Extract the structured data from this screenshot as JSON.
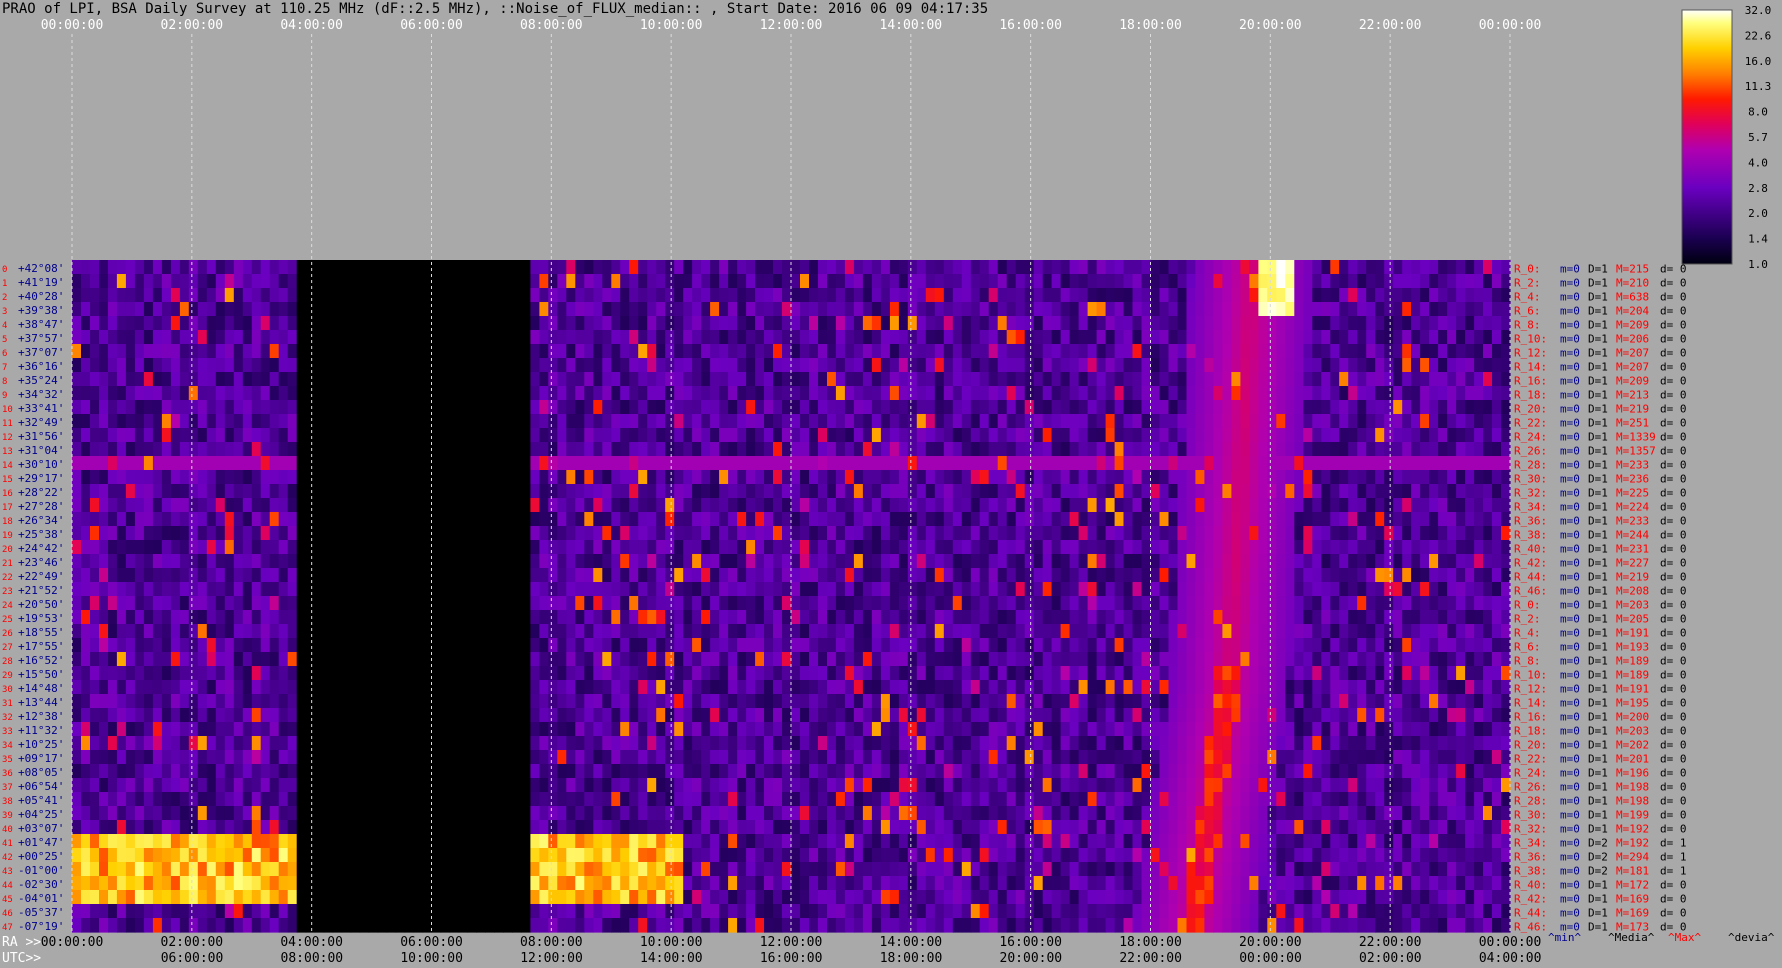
{
  "title": "PRAO of LPI, BSA Daily Survey at 110.25 MHz (dF::2.5 MHz), ::Noise_of_FLUX_median:: , Start Date: 2016 06 09 04:17:35",
  "chart_data": {
    "type": "heatmap",
    "title": "PRAO of LPI, BSA Daily Survey at 110.25 MHz (dF::2.5 MHz), ::Noise_of_FLUX_median:: , Start Date: 2016 06 09 04:17:35",
    "top_time_ticks": [
      "00:00:00",
      "02:00:00",
      "04:00:00",
      "06:00:00",
      "08:00:00",
      "10:00:00",
      "12:00:00",
      "14:00:00",
      "16:00:00",
      "18:00:00",
      "20:00:00",
      "22:00:00",
      "00:00:00"
    ],
    "ra_axis_label": "RA >>",
    "ra_ticks": [
      "00:00:00",
      "02:00:00",
      "04:00:00",
      "06:00:00",
      "08:00:00",
      "10:00:00",
      "12:00:00",
      "14:00:00",
      "16:00:00",
      "18:00:00",
      "20:00:00",
      "22:00:00",
      "00:00:00"
    ],
    "utc_axis_label": "UTC>>",
    "utc_ticks": [
      "06:00:00",
      "08:00:00",
      "10:00:00",
      "12:00:00",
      "14:00:00",
      "16:00:00",
      "18:00:00",
      "20:00:00",
      "22:00:00",
      "00:00:00",
      "02:00:00",
      "04:00:00"
    ],
    "declinations": [
      "+42°08'",
      "+41°19'",
      "+40°28'",
      "+39°38'",
      "+38°47'",
      "+37°57'",
      "+37°07'",
      "+36°16'",
      "+35°24'",
      "+34°32'",
      "+33°41'",
      "+32°49'",
      "+31°56'",
      "+31°04'",
      "+30°10'",
      "+29°17'",
      "+28°22'",
      "+27°28'",
      "+26°34'",
      "+25°38'",
      "+24°42'",
      "+23°46'",
      "+22°49'",
      "+21°52'",
      "+20°50'",
      "+19°53'",
      "+18°55'",
      "+17°55'",
      "+16°52'",
      "+15°50'",
      "+14°48'",
      "+13°44'",
      "+12°38'",
      "+11°32'",
      "+10°25'",
      "+09°17'",
      "+08°05'",
      "+06°54'",
      "+05°41'",
      "+04°25'",
      "+03°07'",
      "+01°47'",
      "+00°25'",
      "-01°00'",
      "-02°30'",
      "-04°01'",
      "-05°37'",
      "-07°19'"
    ],
    "beam_numbers": [
      "0",
      "1",
      "2",
      "3",
      "4",
      "5",
      "6",
      "7",
      "8",
      "9",
      "10",
      "11",
      "12",
      "13",
      "14",
      "15",
      "16",
      "17",
      "18",
      "19",
      "20",
      "21",
      "22",
      "23",
      "24",
      "25",
      "26",
      "27",
      "28",
      "29",
      "30",
      "31",
      "32",
      "33",
      "34",
      "35",
      "36",
      "37",
      "38",
      "39",
      "40",
      "41",
      "42",
      "43",
      "44",
      "45",
      "46",
      "47"
    ],
    "colorbar_ticks": [
      "32.0",
      "22.6",
      "16.0",
      "11.3",
      "8.0",
      "5.7",
      "4.0",
      "2.8",
      "2.0",
      "1.4",
      "1.0"
    ],
    "channels": [
      {
        "r": "R_0:",
        "min": "m=0",
        "dev": "D=1",
        "max": "M=215",
        "d": "d= 0"
      },
      {
        "r": "R_2:",
        "min": "m=0",
        "dev": "D=1",
        "max": "M=210",
        "d": "d= 0"
      },
      {
        "r": "R_4:",
        "min": "m=0",
        "dev": "D=1",
        "max": "M=638",
        "d": "d= 0"
      },
      {
        "r": "R_6:",
        "min": "m=0",
        "dev": "D=1",
        "max": "M=204",
        "d": "d= 0"
      },
      {
        "r": "R_8:",
        "min": "m=0",
        "dev": "D=1",
        "max": "M=209",
        "d": "d= 0"
      },
      {
        "r": "R_10:",
        "min": "m=0",
        "dev": "D=1",
        "max": "M=206",
        "d": "d= 0"
      },
      {
        "r": "R_12:",
        "min": "m=0",
        "dev": "D=1",
        "max": "M=207",
        "d": "d= 0"
      },
      {
        "r": "R_14:",
        "min": "m=0",
        "dev": "D=1",
        "max": "M=207",
        "d": "d= 0"
      },
      {
        "r": "R_16:",
        "min": "m=0",
        "dev": "D=1",
        "max": "M=209",
        "d": "d= 0"
      },
      {
        "r": "R_18:",
        "min": "m=0",
        "dev": "D=1",
        "max": "M=213",
        "d": "d= 0"
      },
      {
        "r": "R_20:",
        "min": "m=0",
        "dev": "D=1",
        "max": "M=219",
        "d": "d= 0"
      },
      {
        "r": "R_22:",
        "min": "m=0",
        "dev": "D=1",
        "max": "M=251",
        "d": "d= 0"
      },
      {
        "r": "R_24:",
        "min": "m=0",
        "dev": "D=1",
        "max": "M=1339",
        "d": "d= 0"
      },
      {
        "r": "R_26:",
        "min": "m=0",
        "dev": "D=1",
        "max": "M=1357",
        "d": "d= 0"
      },
      {
        "r": "R_28:",
        "min": "m=0",
        "dev": "D=1",
        "max": "M=233",
        "d": "d= 0"
      },
      {
        "r": "R_30:",
        "min": "m=0",
        "dev": "D=1",
        "max": "M=236",
        "d": "d= 0"
      },
      {
        "r": "R_32:",
        "min": "m=0",
        "dev": "D=1",
        "max": "M=225",
        "d": "d= 0"
      },
      {
        "r": "R_34:",
        "min": "m=0",
        "dev": "D=1",
        "max": "M=224",
        "d": "d= 0"
      },
      {
        "r": "R_36:",
        "min": "m=0",
        "dev": "D=1",
        "max": "M=233",
        "d": "d= 0"
      },
      {
        "r": "R_38:",
        "min": "m=0",
        "dev": "D=1",
        "max": "M=244",
        "d": "d= 0"
      },
      {
        "r": "R_40:",
        "min": "m=0",
        "dev": "D=1",
        "max": "M=231",
        "d": "d= 0"
      },
      {
        "r": "R_42:",
        "min": "m=0",
        "dev": "D=1",
        "max": "M=227",
        "d": "d= 0"
      },
      {
        "r": "R_44:",
        "min": "m=0",
        "dev": "D=1",
        "max": "M=219",
        "d": "d= 0"
      },
      {
        "r": "R_46:",
        "min": "m=0",
        "dev": "D=1",
        "max": "M=208",
        "d": "d= 0"
      },
      {
        "r": "R_0:",
        "min": "m=0",
        "dev": "D=1",
        "max": "M=203",
        "d": "d= 0"
      },
      {
        "r": "R_2:",
        "min": "m=0",
        "dev": "D=1",
        "max": "M=205",
        "d": "d= 0"
      },
      {
        "r": "R_4:",
        "min": "m=0",
        "dev": "D=1",
        "max": "M=191",
        "d": "d= 0"
      },
      {
        "r": "R_6:",
        "min": "m=0",
        "dev": "D=1",
        "max": "M=193",
        "d": "d= 0"
      },
      {
        "r": "R_8:",
        "min": "m=0",
        "dev": "D=1",
        "max": "M=189",
        "d": "d= 0"
      },
      {
        "r": "R_10:",
        "min": "m=0",
        "dev": "D=1",
        "max": "M=189",
        "d": "d= 0"
      },
      {
        "r": "R_12:",
        "min": "m=0",
        "dev": "D=1",
        "max": "M=191",
        "d": "d= 0"
      },
      {
        "r": "R_14:",
        "min": "m=0",
        "dev": "D=1",
        "max": "M=195",
        "d": "d= 0"
      },
      {
        "r": "R_16:",
        "min": "m=0",
        "dev": "D=1",
        "max": "M=200",
        "d": "d= 0"
      },
      {
        "r": "R_18:",
        "min": "m=0",
        "dev": "D=1",
        "max": "M=203",
        "d": "d= 0"
      },
      {
        "r": "R_20:",
        "min": "m=0",
        "dev": "D=1",
        "max": "M=202",
        "d": "d= 0"
      },
      {
        "r": "R_22:",
        "min": "m=0",
        "dev": "D=1",
        "max": "M=201",
        "d": "d= 0"
      },
      {
        "r": "R_24:",
        "min": "m=0",
        "dev": "D=1",
        "max": "M=196",
        "d": "d= 0"
      },
      {
        "r": "R_26:",
        "min": "m=0",
        "dev": "D=1",
        "max": "M=198",
        "d": "d= 0"
      },
      {
        "r": "R_28:",
        "min": "m=0",
        "dev": "D=1",
        "max": "M=198",
        "d": "d= 0"
      },
      {
        "r": "R_30:",
        "min": "m=0",
        "dev": "D=1",
        "max": "M=199",
        "d": "d= 0"
      },
      {
        "r": "R_32:",
        "min": "m=0",
        "dev": "D=1",
        "max": "M=192",
        "d": "d= 0"
      },
      {
        "r": "R_34:",
        "min": "m=0",
        "dev": "D=2",
        "max": "M=192",
        "d": "d= 1"
      },
      {
        "r": "R_36:",
        "min": "m=0",
        "dev": "D=2",
        "max": "M=294",
        "d": "d= 1"
      },
      {
        "r": "R_38:",
        "min": "m=0",
        "dev": "D=2",
        "max": "M=181",
        "d": "d= 1"
      },
      {
        "r": "R_40:",
        "min": "m=0",
        "dev": "D=1",
        "max": "M=172",
        "d": "d= 0"
      },
      {
        "r": "R_42:",
        "min": "m=0",
        "dev": "D=1",
        "max": "M=169",
        "d": "d= 0"
      },
      {
        "r": "R_44:",
        "min": "m=0",
        "dev": "D=1",
        "max": "M=169",
        "d": "d= 0"
      },
      {
        "r": "R_46:",
        "min": "m=0",
        "dev": "D=1",
        "max": "M=173",
        "d": "d= 0"
      }
    ],
    "legend_labels": [
      "^min^",
      "^Media^",
      "^Max^",
      "^devia^"
    ],
    "colors": {
      "background": "#a9a9a9",
      "text": "#000000",
      "beam_red": "#ff0000",
      "min_blue": "#00008b",
      "max_red": "#ff0000"
    }
  }
}
